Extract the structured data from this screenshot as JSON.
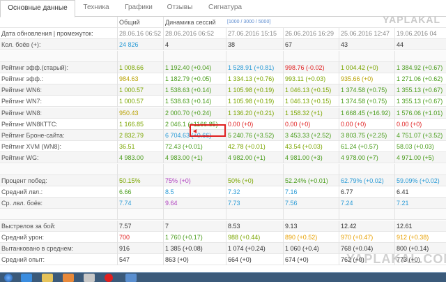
{
  "tabs": [
    {
      "label": "Основные данные",
      "active": true
    },
    {
      "label": "Техника",
      "active": false
    },
    {
      "label": "Графики",
      "active": false
    },
    {
      "label": "Отзывы",
      "active": false
    },
    {
      "label": "Сигнатура",
      "active": false
    }
  ],
  "logo": "YAPLAKAL",
  "watermark": "YAPLAKAL.COM",
  "header": {
    "col_total": "Общий",
    "col_dynamics": "Динамика сессий",
    "dyn_filter": "[1000 / 3000 / 5000]"
  },
  "rows": [
    {
      "label": "Дата обновления | промежуток:",
      "total": "28.06.16 06:52",
      "vals": [
        "28.06.2016 06:52",
        "27.06.2016 15:15",
        "26.06.2016 16:29",
        "25.06.2016 12:47",
        "19.06.2016 04"
      ]
    },
    {
      "label": "Кол. боёв (+):",
      "total": "24 826",
      "vals": [
        "4",
        "38",
        "67",
        "43",
        "44"
      ]
    },
    {
      "label": "",
      "total": "",
      "vals": [
        "",
        "",
        "",
        "",
        ""
      ]
    },
    {
      "label": "Рейтинг эфф.(старый):",
      "total": "1 008.66",
      "vals": [
        "1 192.40 (+0.04)",
        "1 528.91 (+0.81)",
        "998.76 (-0.02)",
        "1 004.42 (+0)",
        "1 384.92 (+0.67)"
      ]
    },
    {
      "label": "Рейтинг эфф.:",
      "total": "984.63",
      "vals": [
        "1 182.79 (+0.05)",
        "1 334.13 (+0.76)",
        "993.11 (+0.03)",
        "935.66 (+0)",
        "1 271.06 (+0.62)"
      ]
    },
    {
      "label": "Рейтинг WN6:",
      "total": "1 000.57",
      "vals": [
        "1 538.63 (+0.14)",
        "1 105.98 (+0.19)",
        "1 046.13 (+0.15)",
        "1 374.58 (+0.75)",
        "1 355.13 (+0.67)"
      ]
    },
    {
      "label": "Рейтинг WN7:",
      "total": "1 000.57",
      "vals": [
        "1 538.63 (+0.14)",
        "1 105.98 (+0.19)",
        "1 046.13 (+0.15)",
        "1 374.58 (+0.75)",
        "1 355.13 (+0.67)"
      ]
    },
    {
      "label": "Рейтинг WN8:",
      "total": "950.43",
      "vals": [
        "2 000.70 (+0.24)",
        "1 136.20 (+0.21)",
        "1 158.32 (+1)",
        "1 668.45 (+16.92)",
        "1 576.06 (+1.01)"
      ]
    },
    {
      "label": "Рейтинг WN8КТТС:",
      "total": "1 166.85",
      "vals": [
        "2 046.1 (+1166.85)",
        "0.00 (+0)",
        "0.00 (+0)",
        "0.00 (+0)",
        "0.00 (+0)"
      ]
    },
    {
      "label": "Рейтинг Броне-сайта:",
      "total": "2 832.79",
      "vals": [
        "6 704.63 (+0.66)",
        "5 240.76 (+3.52)",
        "3 453.33 (+2.52)",
        "3 803.75 (+2.25)",
        "4 751.07 (+3.52)"
      ]
    },
    {
      "label": "Рейтинг XVM (WN8):",
      "total": "36.51",
      "vals": [
        "72.43 (+0.01)",
        "42.78 (+0.01)",
        "43.54 (+0.03)",
        "61.24 (+0.57)",
        "58.03 (+0.03)"
      ]
    },
    {
      "label": "Рейтинг WG:",
      "total": "4 983.00",
      "vals": [
        "4 983.00 (+1)",
        "4 982.00 (+1)",
        "4 981.00 (+3)",
        "4 978.00 (+7)",
        "4 971.00 (+5)"
      ]
    },
    {
      "label": "",
      "total": "",
      "vals": [
        "",
        "",
        "",
        "",
        ""
      ]
    },
    {
      "label": "Процент побед:",
      "total": "50.15%",
      "vals": [
        "75% (+0)",
        "50% (+0)",
        "52.24% (+0.01)",
        "62.79% (+0.02)",
        "59.09% (+0.02)"
      ]
    },
    {
      "label": "Средний лвл.:",
      "total": "6.66",
      "vals": [
        "8.5",
        "7.32",
        "7.16",
        "6.77",
        "6.41"
      ]
    },
    {
      "label": "Ср. лвл. боёв:",
      "total": "7.74",
      "vals": [
        "9.64",
        "7.73",
        "7.56",
        "7.24",
        "7.21"
      ]
    },
    {
      "label": "",
      "total": "",
      "vals": [
        "",
        "",
        "",
        "",
        ""
      ]
    },
    {
      "label": "Выстрелов за бой:",
      "total": "7.57",
      "vals": [
        "7",
        "8.53",
        "9.13",
        "12.42",
        "12.61"
      ]
    },
    {
      "label": "Средний урон:",
      "total": "700",
      "vals": [
        "1 760 (+0.17)",
        "988 (+0.44)",
        "890 (+0.52)",
        "970 (+0.47)",
        "912 (+0.38)"
      ]
    },
    {
      "label": "Вытанковано в среднем:",
      "total": "916",
      "vals": [
        "1 385 (+0.08)",
        "1 074 (+0.24)",
        "1 060 (+0.4)",
        "768 (+0.04)",
        "800 (+0.14)"
      ]
    },
    {
      "label": "Средний опыт:",
      "total": "547",
      "vals": [
        "863 (+0)",
        "664 (+0)",
        "674 (+0)",
        "762 (+0)",
        "773 (+0)"
      ]
    }
  ],
  "colors": {
    "row_colors": [
      [
        "c-gray",
        "c-gray",
        "c-gray",
        "c-gray",
        "c-gray",
        "c-gray"
      ],
      [
        "c-blue",
        "c-dark",
        "c-dark",
        "c-dark",
        "c-dark",
        "c-dark"
      ],
      [
        "",
        "",
        "",
        "",
        "",
        ""
      ],
      [
        "c-lime",
        "c-green",
        "c-blue",
        "c-red",
        "c-lime",
        "c-green"
      ],
      [
        "c-yellow",
        "c-green",
        "c-lime",
        "c-lime",
        "c-yellow",
        "c-green"
      ],
      [
        "c-lime",
        "c-green",
        "c-lime",
        "c-lime",
        "c-green",
        "c-green"
      ],
      [
        "c-lime",
        "c-green",
        "c-lime",
        "c-lime",
        "c-green",
        "c-green"
      ],
      [
        "c-yellow",
        "c-green",
        "c-lime",
        "c-lime",
        "c-green",
        "c-green"
      ],
      [
        "c-lime",
        "c-green",
        "c-red",
        "c-red",
        "c-red",
        "c-red"
      ],
      [
        "c-lime",
        "c-blue",
        "c-green",
        "c-green",
        "c-green",
        "c-green"
      ],
      [
        "c-lime",
        "c-green",
        "c-lime",
        "c-lime",
        "c-green",
        "c-green"
      ],
      [
        "c-green",
        "c-green",
        "c-green",
        "c-green",
        "c-green",
        "c-green"
      ],
      [
        "",
        "",
        "",
        "",
        "",
        ""
      ],
      [
        "c-lime",
        "c-purple",
        "c-lime",
        "c-green",
        "c-blue",
        "c-blue"
      ],
      [
        "c-green",
        "c-blue",
        "c-blue",
        "c-blue",
        "c-dark",
        "c-dark"
      ],
      [
        "c-blue",
        "c-purple",
        "c-blue",
        "c-blue",
        "c-blue",
        "c-blue"
      ],
      [
        "",
        "",
        "",
        "",
        "",
        ""
      ],
      [
        "c-dark",
        "c-dark",
        "c-dark",
        "c-dark",
        "c-dark",
        "c-dark"
      ],
      [
        "c-red",
        "c-green",
        "c-lime",
        "c-orange",
        "c-orange",
        "c-orange"
      ],
      [
        "c-dark",
        "c-dark",
        "c-dark",
        "c-dark",
        "c-dark",
        "c-dark"
      ],
      [
        "c-dark",
        "c-dark",
        "c-dark",
        "c-dark",
        "c-dark",
        "c-dark"
      ]
    ],
    "highlight": "#e02020",
    "taskbar": "#3b5a7a"
  },
  "taskbar_icons": [
    "start-orb-icon",
    "ie-icon",
    "folder-icon",
    "media-icon",
    "opera-icon",
    "network-icon"
  ]
}
